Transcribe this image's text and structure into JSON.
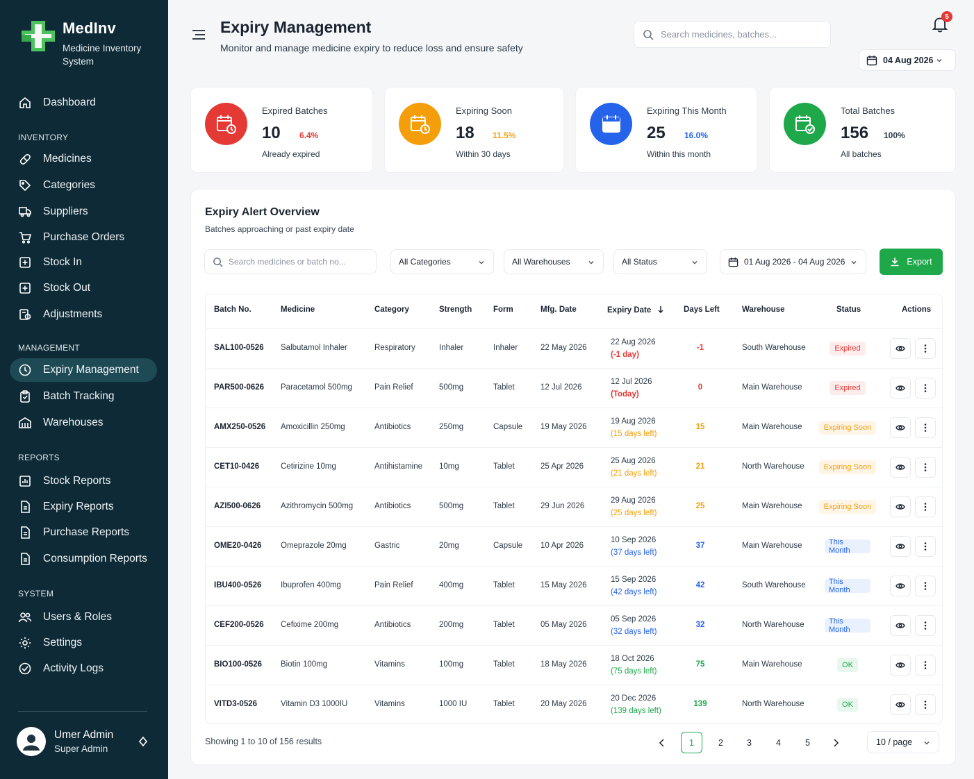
{
  "sidebar": {
    "brand_name": "MedInv",
    "brand_sub": "Medicine Inventory System",
    "dashboard": "Dashboard",
    "sections": {
      "inventory": "INVENTORY",
      "management": "MANAGEMENT",
      "reports": "REPORTS",
      "system": "SYSTEM"
    },
    "inventory_items": [
      "Medicines",
      "Categories",
      "Suppliers",
      "Purchase Orders",
      "Stock In",
      "Stock Out",
      "Adjustments"
    ],
    "management_items": [
      "Expiry Management",
      "Batch Tracking",
      "Warehouses"
    ],
    "report_items": [
      "Stock Reports",
      "Expiry Reports",
      "Purchase Reports",
      "Consumption Reports"
    ],
    "system_items": [
      "Users & Roles",
      "Settings",
      "Activity Logs"
    ],
    "user": {
      "name": "Umer Admin",
      "role": "Super Admin"
    }
  },
  "header": {
    "title": "Expiry Management",
    "subtitle": "Monitor and manage medicine expiry to reduce loss and ensure safety",
    "search_placeholder": "Search medicines, batches...",
    "notification_count": "5",
    "date": "04 Aug 2026"
  },
  "stats": [
    {
      "label": "Expired Batches",
      "value": "10",
      "pct": "6.4%",
      "note": "Already expired",
      "color": "#e53935"
    },
    {
      "label": "Expiring Soon",
      "value": "18",
      "pct": "11.5%",
      "note": "Within 30 days",
      "color": "#f59e0b"
    },
    {
      "label": "Expiring This Month",
      "value": "25",
      "pct": "16.0%",
      "note": "Within this month",
      "color": "#2563eb"
    },
    {
      "label": "Total Batches",
      "value": "156",
      "pct": "100%",
      "note": "All batches",
      "color": "#1fa84a"
    }
  ],
  "panel": {
    "title": "Expiry Alert Overview",
    "subtitle": "Batches approaching or past expiry date",
    "filters": {
      "search_placeholder": "Search medicines or batch no...",
      "category": "All Categories",
      "warehouse": "All Warehouses",
      "status": "All Status",
      "date_range": "01 Aug 2026 - 04 Aug 2026"
    },
    "export_label": "Export",
    "columns": [
      "Batch No.",
      "Medicine",
      "Category",
      "Strength",
      "Form",
      "Mfg. Date",
      "Expiry Date",
      "Days Left",
      "Warehouse",
      "Status",
      "Actions"
    ],
    "rows": [
      {
        "batch": "SAL100-0526",
        "medicine": "Salbutamol Inhaler",
        "category": "Respiratory",
        "strength": "Inhaler",
        "form": "Inhaler",
        "mfg": "22 May 2026",
        "expiry": "22 Aug 2026",
        "expiry_note": "(-1 day)",
        "days": "-1",
        "warehouse": "South Warehouse",
        "status": "Expired"
      },
      {
        "batch": "PAR500-0626",
        "medicine": "Paracetamol 500mg",
        "category": "Pain Relief",
        "strength": "500mg",
        "form": "Tablet",
        "mfg": "12 Jul 2026",
        "expiry": "12 Jul 2026",
        "expiry_note": "(Today)",
        "days": "0",
        "warehouse": "Main Warehouse",
        "status": "Expired"
      },
      {
        "batch": "AMX250-0526",
        "medicine": "Amoxicillin 250mg",
        "category": "Antibiotics",
        "strength": "250mg",
        "form": "Capsule",
        "mfg": "19 May 2026",
        "expiry": "19 Aug 2026",
        "expiry_note": "(15 days left)",
        "days": "15",
        "warehouse": "Main Warehouse",
        "status": "Expiring Soon"
      },
      {
        "batch": "CET10-0426",
        "medicine": "Cetirizine 10mg",
        "category": "Antihistamine",
        "strength": "10mg",
        "form": "Tablet",
        "mfg": "25 Apr 2026",
        "expiry": "25 Aug 2026",
        "expiry_note": "(21 days left)",
        "days": "21",
        "warehouse": "North Warehouse",
        "status": "Expiring Soon"
      },
      {
        "batch": "AZI500-0626",
        "medicine": "Azithromycin 500mg",
        "category": "Antibiotics",
        "strength": "500mg",
        "form": "Tablet",
        "mfg": "29 Jun 2026",
        "expiry": "29 Aug 2026",
        "expiry_note": "(25 days left)",
        "days": "25",
        "warehouse": "Main Warehouse",
        "status": "Expiring Soon"
      },
      {
        "batch": "OME20-0426",
        "medicine": "Omeprazole 20mg",
        "category": "Gastric",
        "strength": "20mg",
        "form": "Capsule",
        "mfg": "10 Apr 2026",
        "expiry": "10 Sep 2026",
        "expiry_note": "(37 days left)",
        "days": "37",
        "warehouse": "Main Warehouse",
        "status": "This Month"
      },
      {
        "batch": "IBU400-0526",
        "medicine": "Ibuprofen 400mg",
        "category": "Pain Relief",
        "strength": "400mg",
        "form": "Tablet",
        "mfg": "15 May 2026",
        "expiry": "15 Sep 2026",
        "expiry_note": "(42 days left)",
        "days": "42",
        "warehouse": "South Warehouse",
        "status": "This Month"
      },
      {
        "batch": "CEF200-0526",
        "medicine": "Cefixime 200mg",
        "category": "Antibiotics",
        "strength": "200mg",
        "form": "Tablet",
        "mfg": "05 May 2026",
        "expiry": "05 Sep 2026",
        "expiry_note": "(32 days left)",
        "days": "32",
        "warehouse": "North Warehouse",
        "status": "This Month"
      },
      {
        "batch": "BIO100-0526",
        "medicine": "Biotin 100mg",
        "category": "Vitamins",
        "strength": "100mg",
        "form": "Tablet",
        "mfg": "18 May 2026",
        "expiry": "18 Oct 2026",
        "expiry_note": "(75 days left)",
        "days": "75",
        "warehouse": "Main Warehouse",
        "status": "OK"
      },
      {
        "batch": "VITD3-0526",
        "medicine": "Vitamin D3 1000IU",
        "category": "Vitamins",
        "strength": "1000 IU",
        "form": "Tablet",
        "mfg": "20 May 2026",
        "expiry": "20 Dec 2026",
        "expiry_note": "(139 days left)",
        "days": "139",
        "warehouse": "North Warehouse",
        "status": "OK"
      }
    ],
    "status_colors": {
      "Expired": {
        "fg": "#e53935",
        "bg": "#fdecec"
      },
      "Expiring Soon": {
        "fg": "#f59e0b",
        "bg": "#fff5e6"
      },
      "This Month": {
        "fg": "#2563eb",
        "bg": "#eaf1fe"
      },
      "OK": {
        "fg": "#1fa84a",
        "bg": "#e8f7ee"
      }
    },
    "footer": {
      "showing": "Showing 1 to 10 of 156 results",
      "pages": [
        "1",
        "2",
        "3",
        "4",
        "5"
      ],
      "per_page": "10 / page"
    }
  }
}
